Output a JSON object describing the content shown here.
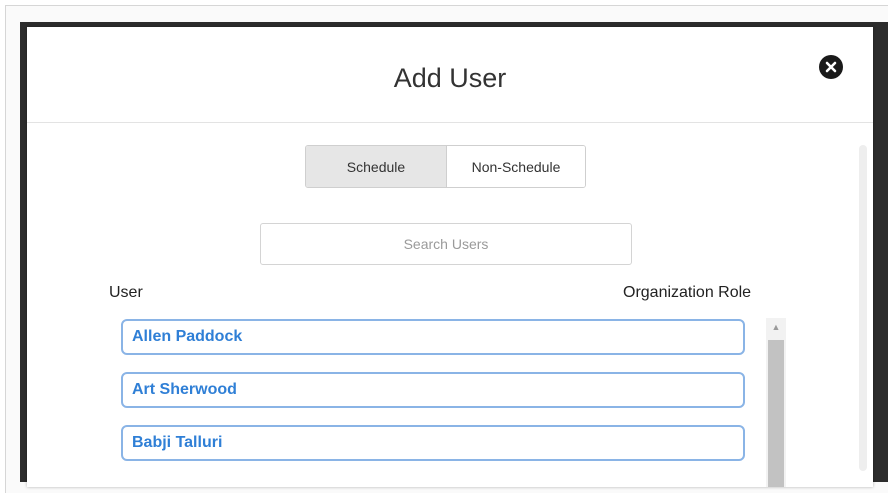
{
  "modal": {
    "title": "Add User",
    "close_icon": "close-x-circle-icon"
  },
  "toggle": {
    "options": [
      {
        "label": "Schedule",
        "selected": true
      },
      {
        "label": "Non-Schedule",
        "selected": false
      }
    ]
  },
  "search": {
    "placeholder": "Search Users",
    "value": ""
  },
  "table": {
    "columns": [
      "User",
      "Organization Role"
    ],
    "users": [
      "Allen Paddock",
      "Art Sherwood",
      "Babji Talluri"
    ]
  },
  "colors": {
    "accent": "#2f7fd6",
    "item_border": "#8ab4e6",
    "selected_toggle": "#e6e6e6"
  }
}
